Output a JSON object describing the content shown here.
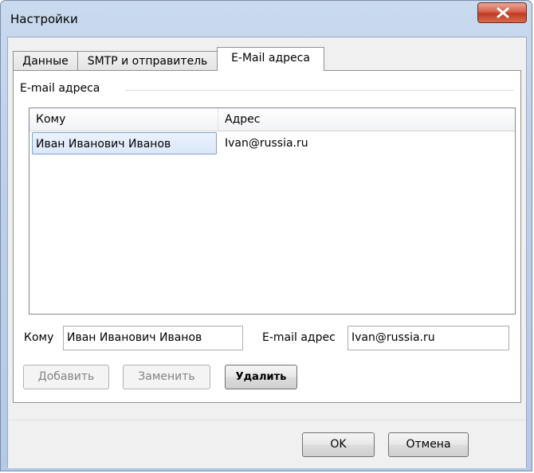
{
  "window": {
    "title": "Настройки"
  },
  "tabs": [
    {
      "label": "Данные"
    },
    {
      "label": "SMTP и отправитель"
    },
    {
      "label": "E-Mail адреса"
    }
  ],
  "group": {
    "label": "E-mail адреса"
  },
  "list": {
    "columns": [
      "Кому",
      "Адрес"
    ],
    "rows": [
      {
        "to": "Иван Иванович Иванов",
        "address": "Ivan@russia.ru"
      }
    ]
  },
  "form": {
    "to_label": "Кому",
    "to_value": "Иван Иванович Иванов",
    "email_label": "E-mail адрес",
    "email_value": "Ivan@russia.ru"
  },
  "actions": {
    "add": "Добавить",
    "replace": "Заменить",
    "delete": "Удалить"
  },
  "dialog_buttons": {
    "ok": "OK",
    "cancel": "Отмена"
  }
}
